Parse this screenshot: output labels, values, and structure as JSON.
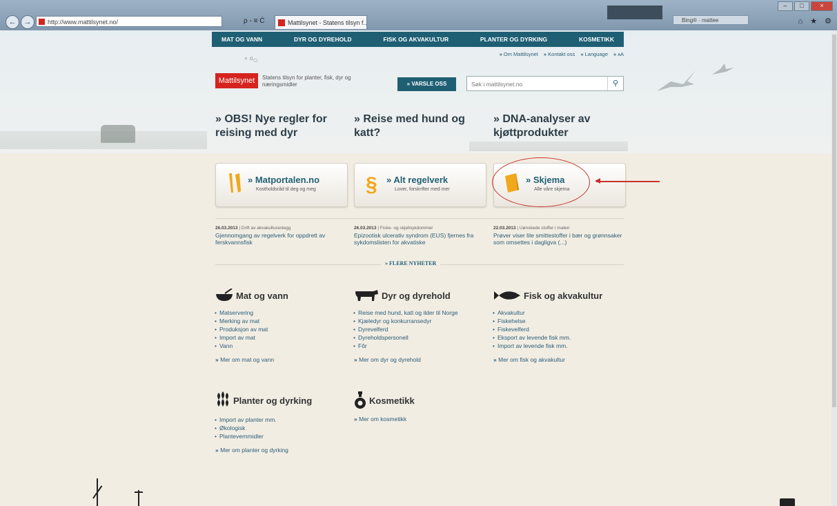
{
  "browser": {
    "address": "http://www.mattilsynet.no/",
    "address_tools": "ρ - ≡ Ċ",
    "tab_title": "Mattilsynet - Statens tilsyn f... ×",
    "search_box": "Bing® · mattee",
    "right_icons": "⌂ ★ ⚙"
  },
  "topnav": [
    "MAT OG VANN",
    "DYR OG DYREHOLD",
    "FISK OG AKVAKULTUR",
    "PLANTER OG DYRKING",
    "KOSMETIKK"
  ],
  "utility": [
    "Om Mattilsynet",
    "Kontakt oss",
    "Language",
    "ᴀA"
  ],
  "logo": {
    "text": "Mattilsynet",
    "tagline": "Statens tilsyn for planter, fisk, dyr og næringsmidler"
  },
  "varsle_label": "VARSLE OSS",
  "search_placeholder": "Søk i mattilsynet.no",
  "headlines": [
    "OBS! Nye regler for reising med dyr",
    "Reise med hund og katt?",
    "DNA-analyser av kjøttprodukter"
  ],
  "cards": [
    {
      "title": "Matportalen.no",
      "sub": "Kostholdsråd til deg og meg"
    },
    {
      "title": "Alt regelverk",
      "sub": "Lover, forskrifter med mer"
    },
    {
      "title": "Skjema",
      "sub": "Alle våre skjema"
    }
  ],
  "news": [
    {
      "date": "26.03.2013",
      "cat": "Drift av akvakulturanlegg",
      "text": "Gjennomgang av regelverk for oppdrett av ferskvannsfisk"
    },
    {
      "date": "26.03.2013",
      "cat": "Fiske- og skjellsykdommer",
      "text": "Epizootisk ulcerativ syndrom (EUS) fjernes fra sykdomslisten for akvatiske"
    },
    {
      "date": "22.03.2013",
      "cat": "Uønskede stoffer i maten",
      "text": "Prøver viser lite smittestoffer i bær og grønnsaker som omsettes i dagligva (...)"
    }
  ],
  "flere_nyheter": "FLERE NYHETER",
  "sections": {
    "mat": {
      "title": "Mat og vann",
      "items": [
        "Matservering",
        "Merking av mat",
        "Produksjon av mat",
        "Import av mat",
        "Vann"
      ],
      "more": "Mer om mat og vann"
    },
    "dyr": {
      "title": "Dyr og dyrehold",
      "items": [
        "Reise med hund, katt og ilder til Norge",
        "Kjæledyr og konkurransedyr",
        "Dyrevelferd",
        "Dyreholdspersonell",
        "Fôr"
      ],
      "more": "Mer om dyr og dyrehold"
    },
    "fisk": {
      "title": "Fisk og akvakultur",
      "items": [
        "Akvakultur",
        "Fiskehelse",
        "Fiskevelferd",
        "Eksport av levende fisk mm.",
        "Import av levende fisk mm."
      ],
      "more": "Mer om fisk og akvakultur"
    },
    "planter": {
      "title": "Planter og dyrking",
      "items": [
        "Import av planter mm.",
        "Økologisk",
        "Plantevernmidler"
      ],
      "more": "Mer om planter og dyrking"
    },
    "kosmetikk": {
      "title": "Kosmetikk",
      "more": "Mer om kosmetikk"
    }
  },
  "colors": {
    "nav": "#1f5f74",
    "logo": "#d6231e",
    "annotation": "#c8312a",
    "card_icon": "#f0a81c"
  }
}
